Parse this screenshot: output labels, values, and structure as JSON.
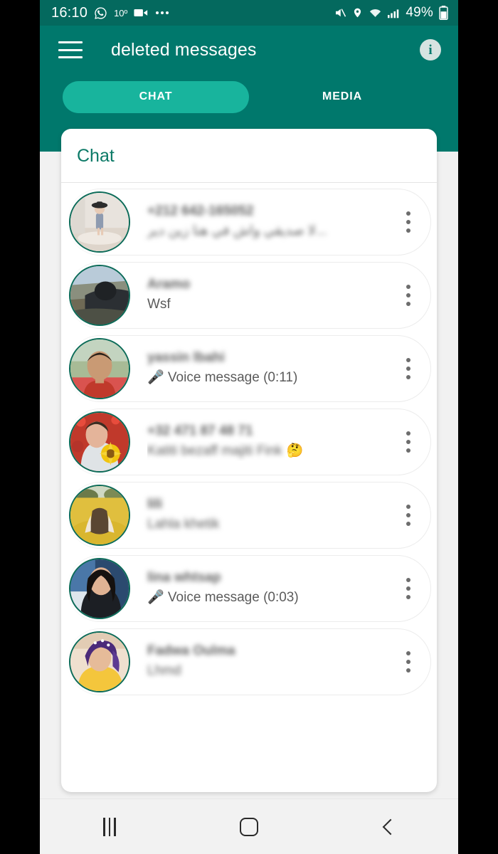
{
  "status_bar": {
    "clock": "16:10",
    "whatsapp_icon": "whatsapp-icon",
    "temperature": "10º",
    "video_icon": "video-camera-icon",
    "overflow_icon": "more-notifications-icon",
    "mute_icon": "volume-mute-icon",
    "location_icon": "location-pin-icon",
    "wifi_icon": "wifi-icon",
    "signal_icon": "cellular-signal-icon",
    "battery_percent": "49%",
    "battery_icon": "battery-icon"
  },
  "app_bar": {
    "menu_icon": "hamburger-menu-icon",
    "title": "deleted messages",
    "info_icon": "info-icon",
    "info_label": "i"
  },
  "tabs": [
    {
      "label": "CHAT",
      "active": true
    },
    {
      "label": "MEDIA",
      "active": false
    }
  ],
  "card": {
    "title": "Chat"
  },
  "chats": [
    {
      "name": "+212 642-165052",
      "message": "لا صديقي واش في هنا زين دير...",
      "name_blurred": true,
      "message_blurred": true,
      "avatar_desc": "child-standing-in-room-photo",
      "menu_icon": "kebab-menu-icon"
    },
    {
      "name": "Aramo",
      "message": "Wsf",
      "name_blurred": true,
      "message_blurred": false,
      "avatar_desc": "mountain-landscape-selfie-photo",
      "menu_icon": "kebab-menu-icon"
    },
    {
      "name": "yassin lbahi",
      "message": "🎤 Voice message (0:11)",
      "name_blurred": true,
      "message_blurred": false,
      "avatar_desc": "young-man-portrait-photo",
      "menu_icon": "kebab-menu-icon"
    },
    {
      "name": "+32 471 87 48 71",
      "message": "Katiti bezaff  majiti  Fink",
      "message_emoji": "🤔",
      "name_blurred": true,
      "message_blurred": true,
      "avatar_desc": "woman-with-sunflower-photo",
      "menu_icon": "kebab-menu-icon"
    },
    {
      "name": "lili",
      "message": "Lahla khetik",
      "name_blurred": true,
      "message_blurred": true,
      "avatar_desc": "person-in-yellow-flower-field-photo",
      "menu_icon": "kebab-menu-icon"
    },
    {
      "name": "lina whtsap",
      "message": "🎤 Voice message (0:03)",
      "name_blurred": true,
      "message_blurred": false,
      "avatar_desc": "woman-dark-hair-selfie-photo",
      "menu_icon": "kebab-menu-icon"
    },
    {
      "name": "Fadwa Oulma",
      "message": "Lhmd",
      "name_blurred": true,
      "message_blurred": true,
      "avatar_desc": "woman-in-yellow-top-selfie-photo",
      "menu_icon": "kebab-menu-icon"
    }
  ],
  "nav_bar": {
    "recents_icon": "recents-icon",
    "home_icon": "home-icon",
    "back_icon": "back-icon"
  },
  "colors": {
    "status_bar": "#04695e",
    "app_bar_teal": "#00786c",
    "tab_active": "#18b49d",
    "card_title": "#0c7a67",
    "avatar_ring": "#0b6b58",
    "page_background": "#f1f1f1",
    "nav_background": "#f2f2f2"
  }
}
